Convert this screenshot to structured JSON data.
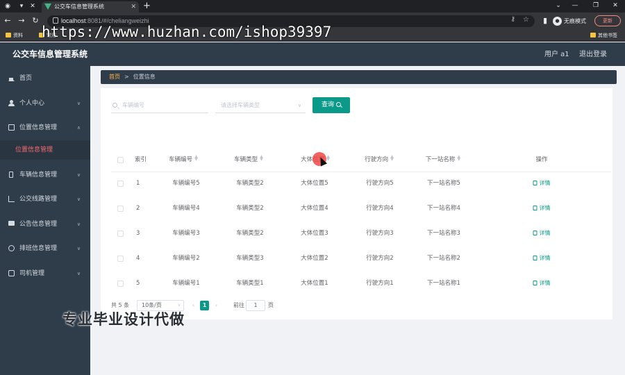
{
  "browser": {
    "tab_title": "公交车信息管理系统",
    "url_host": "localhost",
    "url_rest": ":8081/#/cheliangweizhi",
    "profile_label": "无痕模式",
    "update_label": "更新",
    "bookmarks": [
      "资料",
      "常用",
      "其他书签"
    ],
    "watermark_url": "https://www.huzhan.com/ishop39397"
  },
  "header": {
    "title": "公交车信息管理系统",
    "user": "用户 a1",
    "logout": "退出登录"
  },
  "sidebar": {
    "items": [
      {
        "label": "首页",
        "icon": "home-icon"
      },
      {
        "label": "个人中心",
        "icon": "person-icon"
      },
      {
        "label": "位置信息管理",
        "icon": "box-icon"
      },
      {
        "label": "位置信息管理",
        "icon": ""
      },
      {
        "label": "车辆信息管理",
        "icon": "phone-icon"
      },
      {
        "label": "公交线路管理",
        "icon": "chart-icon"
      },
      {
        "label": "公告信息管理",
        "icon": "chat-icon"
      },
      {
        "label": "排班信息管理",
        "icon": "globe-icon"
      },
      {
        "label": "司机管理",
        "icon": "doc-icon"
      }
    ]
  },
  "breadcrumb": {
    "home": "首页",
    "separator": ">",
    "current": "位置信息"
  },
  "search": {
    "vehicle_no_placeholder": "车辆编号",
    "type_placeholder": "请选择车辆类型",
    "query_label": "查询"
  },
  "table": {
    "headers": [
      "索引",
      "车辆编号",
      "车辆类型",
      "大体位置",
      "行驶方向",
      "下一站名称",
      "操作"
    ],
    "rows": [
      {
        "index": "1",
        "vehicle_no": "车辆编号5",
        "type": "车辆类型2",
        "location": "大体位置5",
        "direction": "行驶方向5",
        "next_stop": "下一站名称5",
        "action": "详情"
      },
      {
        "index": "2",
        "vehicle_no": "车辆编号4",
        "type": "车辆类型2",
        "location": "大体位置4",
        "direction": "行驶方向4",
        "next_stop": "下一站名称4",
        "action": "详情"
      },
      {
        "index": "3",
        "vehicle_no": "车辆编号3",
        "type": "车辆类型2",
        "location": "大体位置3",
        "direction": "行驶方向3",
        "next_stop": "下一站名称3",
        "action": "详情"
      },
      {
        "index": "4",
        "vehicle_no": "车辆编号2",
        "type": "车辆类型3",
        "location": "大体位置2",
        "direction": "行驶方向2",
        "next_stop": "下一站名称2",
        "action": "详情"
      },
      {
        "index": "5",
        "vehicle_no": "车辆编号1",
        "type": "车辆类型1",
        "location": "大体位置1",
        "direction": "行驶方向1",
        "next_stop": "下一站名称1",
        "action": "详情"
      }
    ]
  },
  "pagination": {
    "total": "共 5 条",
    "page_size": "10条/页",
    "current_page": "1",
    "goto_label": "前往",
    "goto_value": "1",
    "page_suffix": "页"
  },
  "overlay_text": "专业毕业设计代做",
  "colors": {
    "sidebar_bg": "#2f3c4a",
    "accent": "#0b9a8a",
    "active_menu": "#f56c6c",
    "breadcrumb_home": "#ffb74d"
  }
}
